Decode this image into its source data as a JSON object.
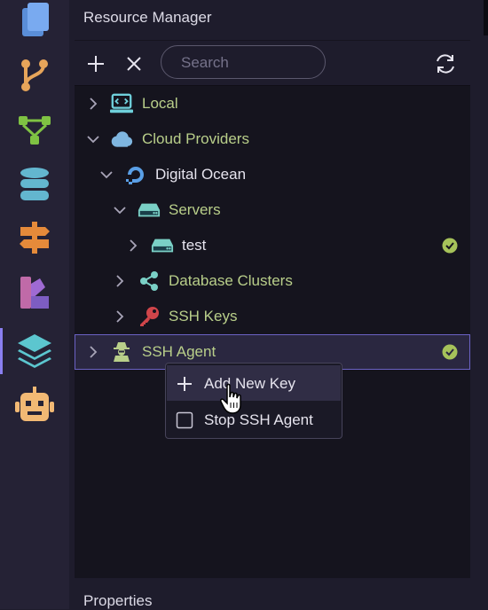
{
  "activity_bar": {
    "items": [
      {
        "name": "documents-icon"
      },
      {
        "name": "source-control-icon"
      },
      {
        "name": "workflow-icon"
      },
      {
        "name": "database-icon"
      },
      {
        "name": "signpost-icon"
      },
      {
        "name": "palette-icon"
      },
      {
        "name": "layers-icon",
        "active": true
      },
      {
        "name": "robot-icon"
      }
    ]
  },
  "panel": {
    "title": "Resource Manager",
    "search_placeholder": "Search",
    "bottom_title": "Properties"
  },
  "tree": [
    {
      "label": "Local",
      "expanded": false,
      "icon": "monitor-code-icon",
      "color": "#b9cf8a"
    },
    {
      "label": "Cloud Providers",
      "expanded": true,
      "icon": "cloud-icon",
      "color": "#b9cf8a"
    },
    {
      "label": "Digital Ocean",
      "expanded": true,
      "icon": "digital-ocean-icon",
      "color": "#e6e4ee"
    },
    {
      "label": "Servers",
      "expanded": true,
      "icon": "server-icon",
      "color": "#b9cf8a"
    },
    {
      "label": "test",
      "expanded": false,
      "icon": "server-icon",
      "color": "#e6e4ee",
      "status": "connected"
    },
    {
      "label": "Database Clusters",
      "expanded": false,
      "icon": "share-nodes-icon",
      "color": "#b9cf8a"
    },
    {
      "label": "SSH Keys",
      "expanded": false,
      "icon": "key-icon",
      "color": "#b9cf8a"
    },
    {
      "label": "SSH Agent",
      "expanded": false,
      "icon": "agent-icon",
      "color": "#b9cf8a",
      "status": "connected",
      "selected": true
    }
  ],
  "context_menu": {
    "items": [
      {
        "label": "Add New Key",
        "icon": "plus-icon",
        "hovered": true
      },
      {
        "label": "Stop SSH Agent",
        "icon": "checkbox-icon",
        "checked": false
      }
    ]
  },
  "colors": {
    "accent": "#8a7ff0",
    "tree_label_green": "#b9cf8a",
    "status_green": "#a6c25a"
  }
}
